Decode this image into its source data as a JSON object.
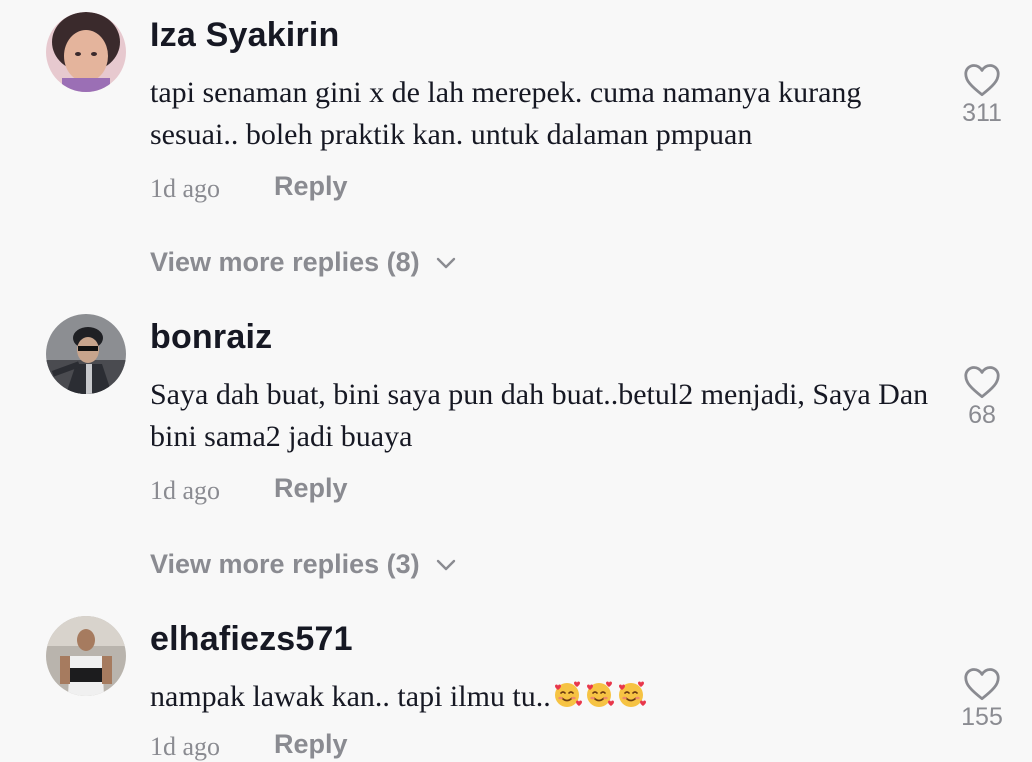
{
  "comments": [
    {
      "username": "Iza Syakirin",
      "text": "tapi senaman gini x de lah merepek. cuma namanya kurang sesuai.. boleh praktik kan. untuk dalaman pmpuan",
      "time": "1d ago",
      "reply_label": "Reply",
      "likes": "311",
      "more_replies": "View more replies (8)"
    },
    {
      "username": "bonraiz",
      "text": "Saya dah buat, bini saya pun dah buat..betul2 menjadi, Saya Dan bini sama2 jadi buaya",
      "time": "1d ago",
      "reply_label": "Reply",
      "likes": "68",
      "more_replies": "View more replies (3)"
    },
    {
      "username": "elhafiezs571",
      "text": "nampak lawak kan.. tapi ilmu tu..",
      "text_emoji": "smiling-face-with-hearts-icon x3",
      "time": "1d ago",
      "reply_label": "Reply",
      "likes": "155"
    }
  ],
  "colors": {
    "background": "#f8f8f8",
    "primary_text": "#161823",
    "secondary_text": "#8a8b91"
  }
}
